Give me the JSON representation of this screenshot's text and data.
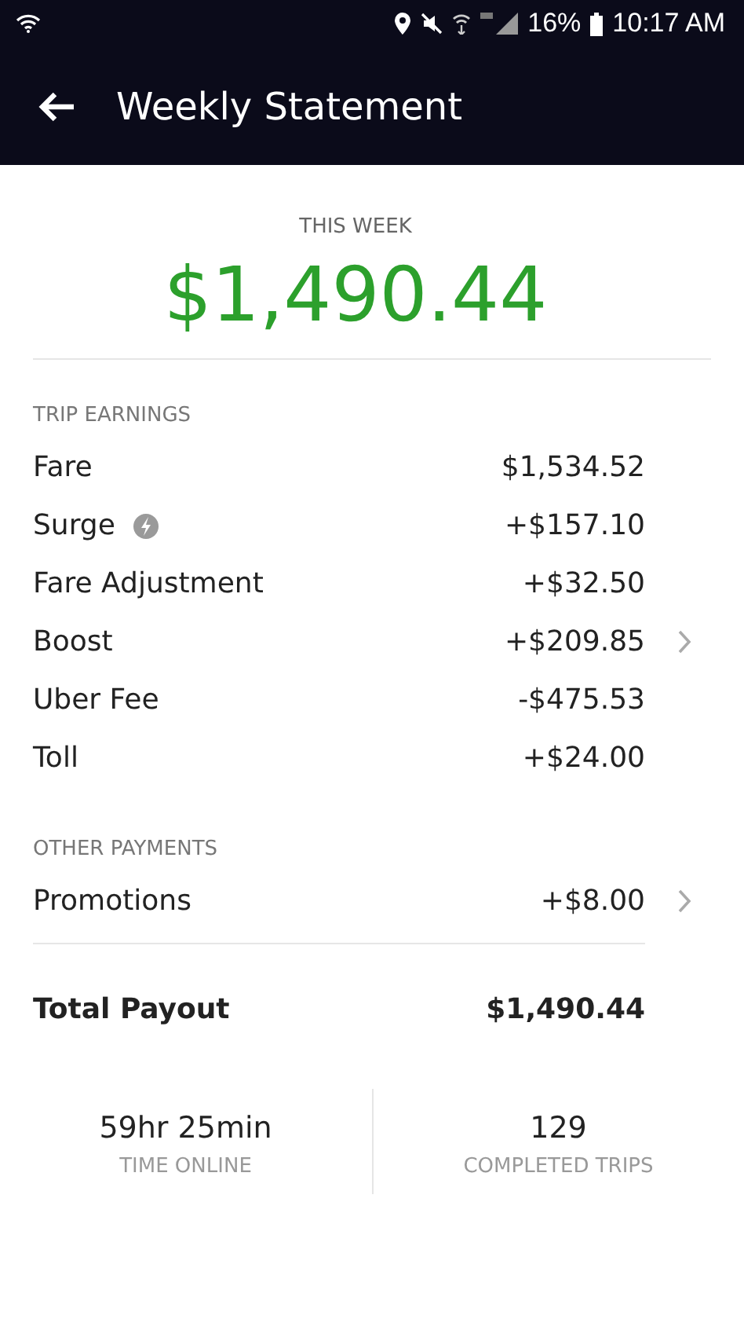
{
  "status_bar": {
    "battery": "16%",
    "time": "10:17 AM"
  },
  "header": {
    "title": "Weekly Statement"
  },
  "summary": {
    "label": "THIS WEEK",
    "amount": "$1,490.44"
  },
  "sections": [
    {
      "title": "TRIP EARNINGS",
      "rows": [
        {
          "kind": "plain",
          "label": "Fare",
          "value": "$1,534.52",
          "chevron": false
        },
        {
          "kind": "surge",
          "label": "Surge",
          "value": "+$157.10",
          "chevron": false
        },
        {
          "kind": "plain",
          "label": "Fare Adjustment",
          "value": "+$32.50",
          "chevron": false
        },
        {
          "kind": "plain",
          "label": "Boost",
          "value": "+$209.85",
          "chevron": true
        },
        {
          "kind": "plain",
          "label": "Uber Fee",
          "value": "-$475.53",
          "chevron": false
        },
        {
          "kind": "plain",
          "label": "Toll",
          "value": "+$24.00",
          "chevron": false
        }
      ]
    },
    {
      "title": "OTHER PAYMENTS",
      "rows": [
        {
          "kind": "plain",
          "label": "Promotions",
          "value": "+$8.00",
          "chevron": true
        }
      ]
    }
  ],
  "total": {
    "label": "Total Payout",
    "value": "$1,490.44"
  },
  "stats": [
    {
      "value": "59hr 25min",
      "label": "TIME ONLINE"
    },
    {
      "value": "129",
      "label": "COMPLETED TRIPS"
    }
  ]
}
